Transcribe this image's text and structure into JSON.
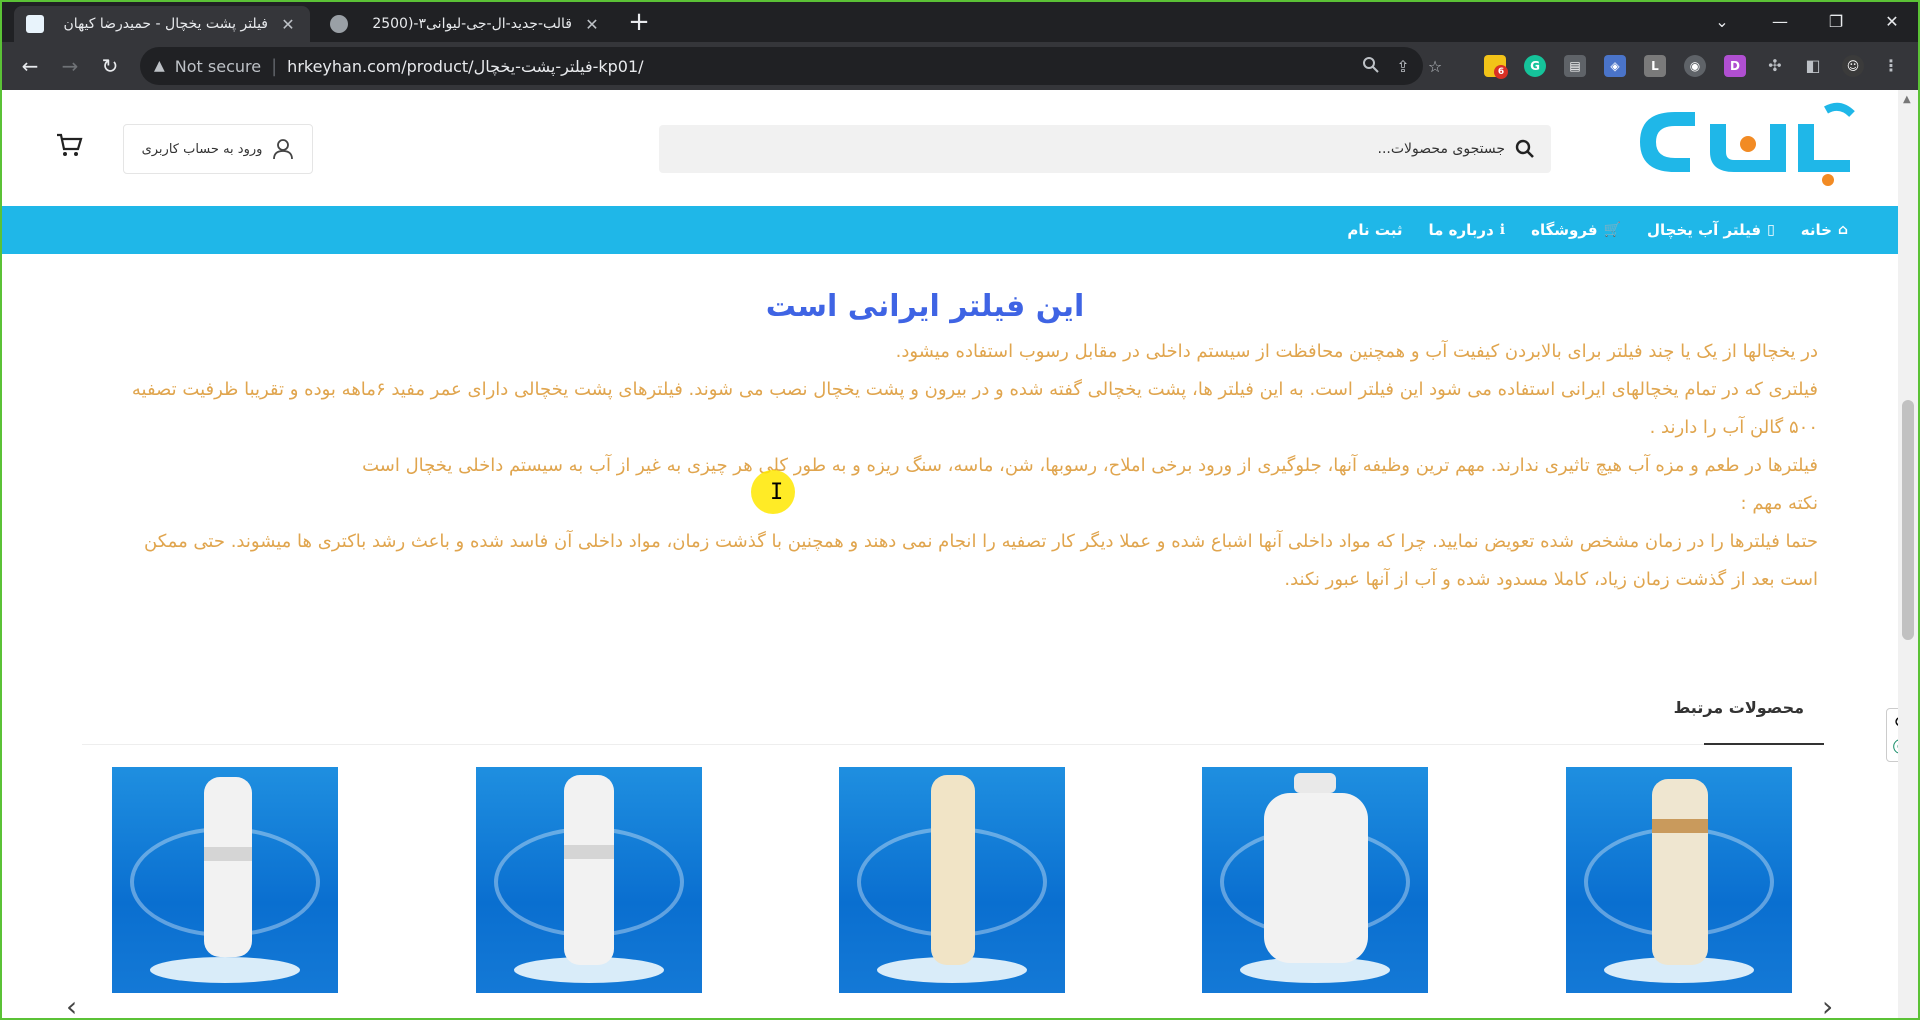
{
  "browser": {
    "tabs": [
      {
        "title": "فیلتر پشت یخچال - حمیدرضا کیهان",
        "active": true
      },
      {
        "title": "قالب-جدید-ال-جی-لیوانی۳-(2500",
        "active": false
      }
    ],
    "window_controls": {
      "minimize": "—",
      "restore": "❐",
      "close": "✕",
      "tab_search": "⌄"
    },
    "new_tab": "+",
    "nav": {
      "back": "←",
      "forward": "→",
      "reload": "↻"
    },
    "address": {
      "security_label": "Not secure",
      "url": "hrkeyhan.com/product/فیلتر-پشت-یخچال-kp01/"
    },
    "extensions_badge": "6"
  },
  "site": {
    "search": {
      "placeholder": "جستجوی محصولات..."
    },
    "login_label": "ورود به حساب کاربری",
    "menu": [
      {
        "label": "خانه",
        "icon": "home-icon",
        "glyph": "⌂"
      },
      {
        "label": "فیلتر آب یخچال",
        "icon": "fridge-icon",
        "glyph": "▯"
      },
      {
        "label": "فروشگاه",
        "icon": "cart-icon",
        "glyph": "🛒"
      },
      {
        "label": "درباره ما",
        "icon": "info-icon",
        "glyph": "ℹ"
      },
      {
        "label": "ثبت نام",
        "icon": "",
        "glyph": ""
      }
    ],
    "accent_color": "#1fb7e8"
  },
  "article": {
    "heading": "این فیلتر ایرانی است",
    "lines": [
      "در یخچالها از یک یا چند فیلتر برای بالابردن کیفیت آب و همچنین محافظت از سیستم داخلی در مقابل رسوب استفاده میشود.",
      "فیلتری که در تمام یخچالهای ایرانی استفاده می شود این فیلتر است. به این فیلتر ها، پشت یخچالی گفته شده و در بیرون و پشت یخچال نصب می شوند. فیلترهای پشت یخچالی دارای عمر مفید ۶ماهه بوده و تقریبا ظرفیت تصفیه ۵۰۰ گالن آب را دارند .",
      "فیلترها در طعم و مزه آب هیچ تاثیری ندارند. مهم ترین وظیفه آنها، جلوگیری از ورود برخی املاح، رسوبها، شن، ماسه، سنگ ریزه و به طور کلی هر چیزی به غیر از آب به سیستم داخلی یخچال است",
      "نکته مهم :",
      "حتما فیلترها را در زمان مشخص شده تعویض نمایید. چرا که مواد داخلی آنها اشباع شده و عملا دیگر کار تصفیه را انجام نمی دهند و همچنین با گذشت زمان، مواد داخلی آن فاسد شده و باعث رشد باکتری ها میشوند. حتی ممکن است بعد از گذشت زمان زیاد، کاملا مسدود شده و آب از آنها عبور نکند."
    ],
    "text_color": "#e0a54e",
    "heading_color": "#3f64e4"
  },
  "related": {
    "title": "محصولات مرتبط",
    "prev": "‹",
    "next": "›"
  }
}
